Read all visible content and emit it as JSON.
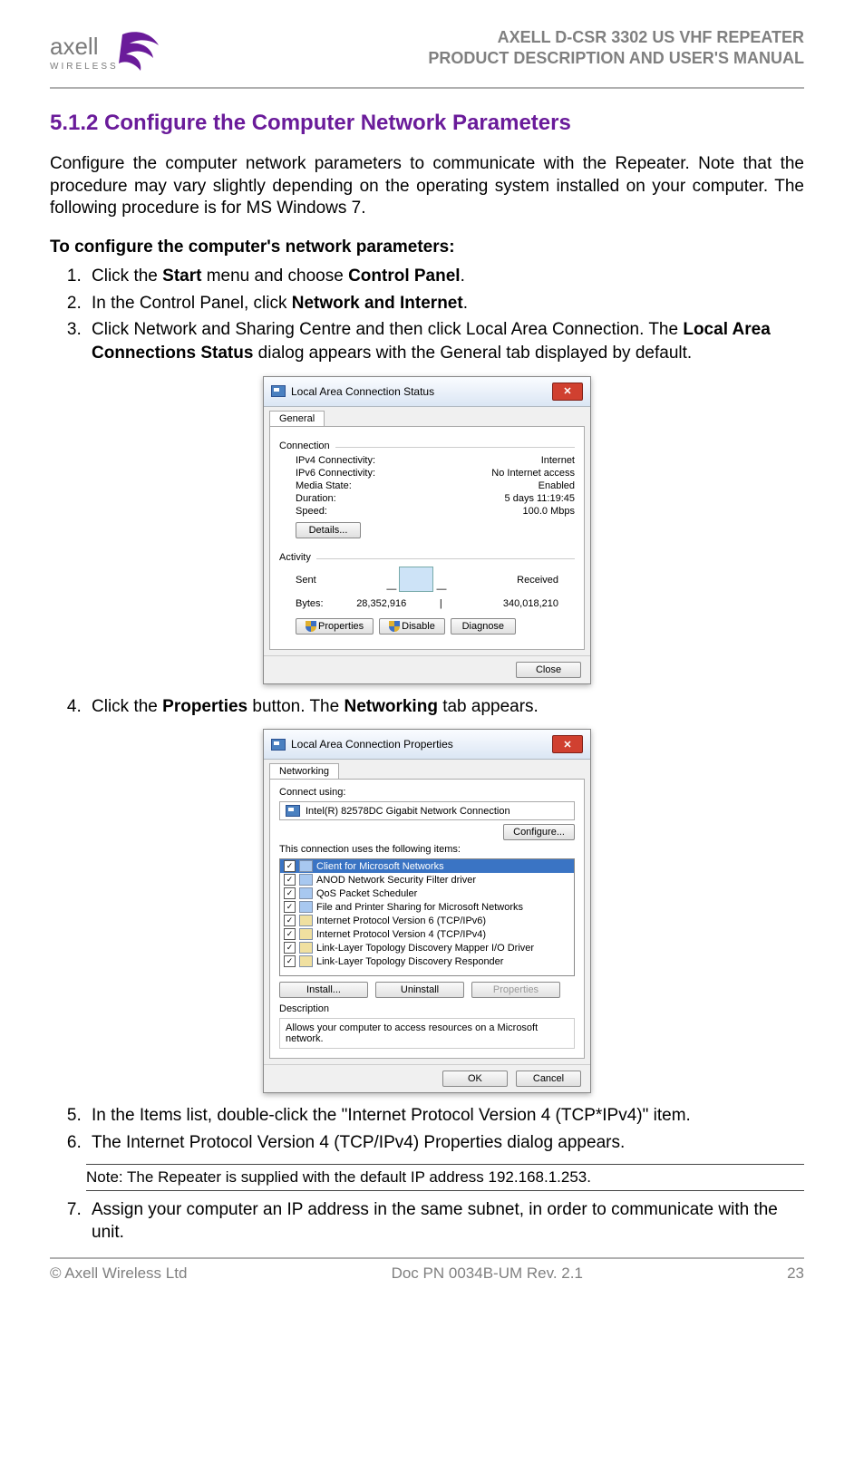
{
  "header": {
    "brand_top": "axell",
    "brand_bottom": "WIRELESS",
    "doc_title_1": "AXELL D-CSR 3302 US VHF REPEATER",
    "doc_title_2": "PRODUCT DESCRIPTION AND USER'S MANUAL"
  },
  "section": {
    "number_title": "5.1.2 Configure the Computer Network Parameters",
    "intro": "Configure the computer network parameters to communicate with the Repeater. Note that the procedure may vary slightly depending on the operating system installed on your computer. The following procedure is for MS Windows 7.",
    "subhead": "To configure the computer's network parameters:"
  },
  "steps": {
    "s1_pre": "Click the ",
    "s1_b1": "Start",
    "s1_mid": " menu and choose ",
    "s1_b2": "Control Panel",
    "s1_post": ".",
    "s2_pre": "In the Control Panel, click ",
    "s2_b1": "Network and Internet",
    "s2_post": ".",
    "s3_pre": "Click Network and Sharing Centre and then click Local Area Connection. The ",
    "s3_b1": "Local Area Connections Status",
    "s3_post": " dialog appears with the General tab displayed by default.",
    "s4_pre": "Click the ",
    "s4_b1": "Properties",
    "s4_mid": " button. The ",
    "s4_b2": "Networking",
    "s4_post": " tab appears.",
    "s5": "In the Items list, double-click the \"Internet Protocol Version 4 (TCP*IPv4)\" item.",
    "s6": "The Internet Protocol Version 4 (TCP/IPv4) Properties dialog appears.",
    "s7": "Assign your computer an IP address in the same subnet, in order to communicate with the unit."
  },
  "note": "Note:  The Repeater is supplied with the default IP address 192.168.1.253.",
  "dialog1": {
    "title": "Local Area Connection Status",
    "tab": "General",
    "group_conn": "Connection",
    "rows": [
      {
        "k": "IPv4 Connectivity:",
        "v": "Internet"
      },
      {
        "k": "IPv6 Connectivity:",
        "v": "No Internet access"
      },
      {
        "k": "Media State:",
        "v": "Enabled"
      },
      {
        "k": "Duration:",
        "v": "5 days 11:19:45"
      },
      {
        "k": "Speed:",
        "v": "100.0 Mbps"
      }
    ],
    "details_btn": "Details...",
    "group_act": "Activity",
    "sent_lbl": "Sent",
    "recv_lbl": "Received",
    "bytes_lbl": "Bytes:",
    "bytes_sent": "28,352,916",
    "bytes_recv": "340,018,210",
    "btn_props": "Properties",
    "btn_disable": "Disable",
    "btn_diag": "Diagnose",
    "btn_close": "Close"
  },
  "dialog2": {
    "title": "Local Area Connection Properties",
    "tab": "Networking",
    "connect_using": "Connect using:",
    "nic": "Intel(R) 82578DC Gigabit Network Connection",
    "btn_configure": "Configure...",
    "uses_label": "This connection uses the following items:",
    "items": [
      "Client for Microsoft Networks",
      "ANOD Network Security Filter driver",
      "QoS Packet Scheduler",
      "File and Printer Sharing for Microsoft Networks",
      "Internet Protocol Version 6 (TCP/IPv6)",
      "Internet Protocol Version 4 (TCP/IPv4)",
      "Link-Layer Topology Discovery Mapper I/O Driver",
      "Link-Layer Topology Discovery Responder"
    ],
    "btn_install": "Install...",
    "btn_uninstall": "Uninstall",
    "btn_itemprops": "Properties",
    "desc_lbl": "Description",
    "desc_text": "Allows your computer to access resources on a Microsoft network.",
    "btn_ok": "OK",
    "btn_cancel": "Cancel"
  },
  "footer": {
    "left": "© Axell Wireless Ltd",
    "center": "Doc PN 0034B-UM Rev. 2.1",
    "right": "23"
  }
}
